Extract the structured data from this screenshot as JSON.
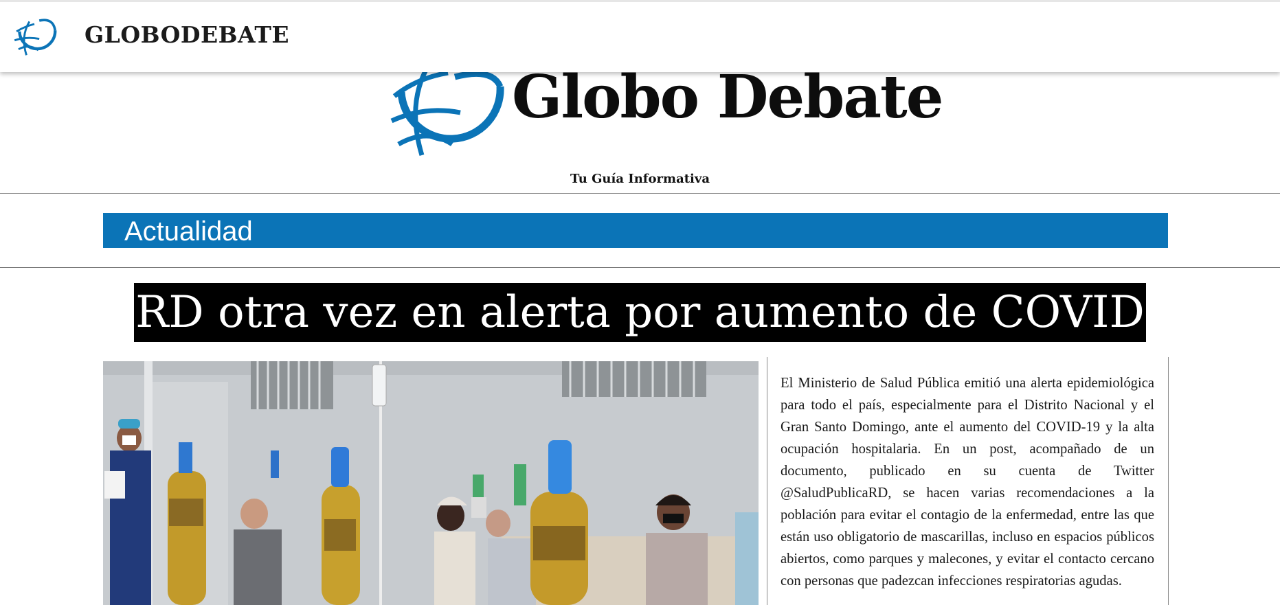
{
  "topbar": {
    "brand_name": "GLOBODEBATE",
    "logo_icon": "globe-logo-icon"
  },
  "masthead": {
    "title": "Globo Debate",
    "tagline": "Tu Guía Informativa",
    "logo_icon": "globe-logo-icon"
  },
  "category": {
    "label": "Actualidad"
  },
  "article": {
    "headline": "RD otra vez en alerta por aumento de COVID",
    "body": "El Ministerio de Salud Pública emitió una alerta epidemiológica para todo el país, especialmente para el Distrito Nacional y el Gran Santo Domingo, ante el aumento del COVID-19 y la alta ocupación hospitalaria. En un post, acompañado de un documento, publicado en su cuenta de Twitter @SaludPublicaRD, se hacen varias recomendaciones a la población para evitar el contagio de la enfermedad, entre las que están uso obligatorio de mascarillas, incluso en espacios públicos abiertos, como parques y malecones, y evitar el contacto cercano con personas que padezcan infecciones respiratorias agudas."
  },
  "colors": {
    "brand_blue": "#0b74b7",
    "headline_bg": "#000000",
    "headline_text": "#ffffff"
  }
}
